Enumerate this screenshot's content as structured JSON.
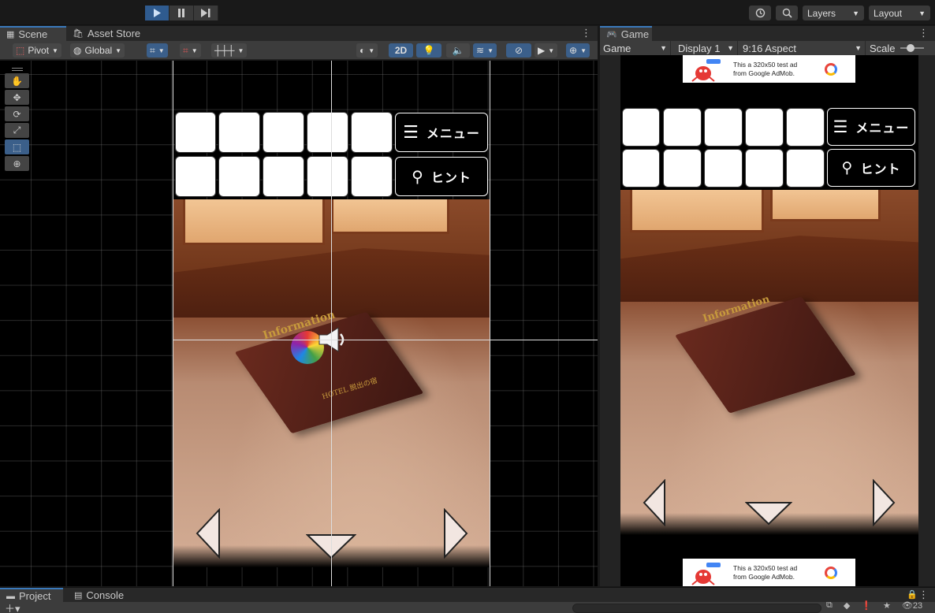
{
  "toolbar": {
    "play_icon": "play-icon",
    "pause_icon": "pause-icon",
    "step_icon": "step-icon",
    "history_icon": "history-icon",
    "search_icon": "search-icon",
    "layers_label": "Layers",
    "layout_label": "Layout"
  },
  "scene": {
    "tabs": [
      {
        "label": "Scene",
        "icon": "grid-icon"
      },
      {
        "label": "Asset Store",
        "icon": "bag-icon"
      }
    ],
    "pivot_label": "Pivot",
    "global_label": "Global",
    "mode_2d_label": "2D",
    "tools": [
      "hand-tool",
      "move-tool",
      "rotate-tool",
      "scale-tool",
      "rect-tool",
      "transform-tool"
    ]
  },
  "game": {
    "tab_label": "Game",
    "target_label": "Game",
    "display_label": "Display 1",
    "aspect_label": "9:16 Aspect",
    "scale_label": "Scale"
  },
  "ingame": {
    "menu_label": "メニュー",
    "hint_label": "ヒント",
    "ad_line1": "This a 320x50 test ad",
    "ad_line2": "from Google AdMob.",
    "book_title": "Information",
    "book_sub": "HOTEL 脱出の宿"
  },
  "bottom": {
    "tabs": [
      {
        "label": "Project",
        "icon": "folder-icon"
      },
      {
        "label": "Console",
        "icon": "console-icon"
      }
    ],
    "visible_count": "23"
  },
  "colors": {
    "accent": "#3a79bb",
    "play_active": "#2f5b8f",
    "panel_bg": "#282828"
  }
}
